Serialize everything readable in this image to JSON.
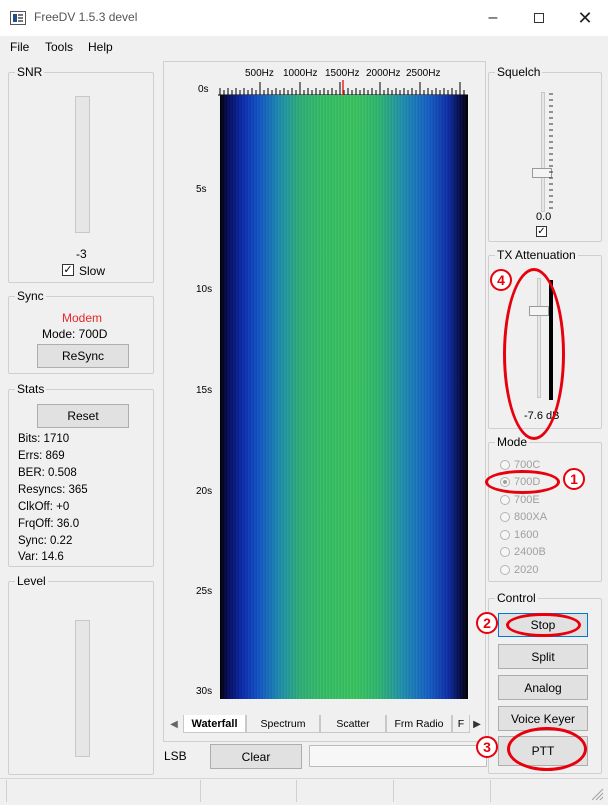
{
  "window": {
    "title": "FreeDV 1.5.3 devel"
  },
  "menu": {
    "items": [
      "File",
      "Tools",
      "Help"
    ]
  },
  "snr": {
    "title": "SNR",
    "value": "-3",
    "slow_label": "Slow"
  },
  "sync": {
    "title": "Sync",
    "status": "Modem",
    "status_color": "#e8262a",
    "mode_text": "Mode: 700D",
    "resync_label": "ReSync"
  },
  "stats": {
    "title": "Stats",
    "reset_label": "Reset",
    "lines": [
      "Bits: 1710",
      "Errs: 869",
      "BER: 0.508",
      "Resyncs: 365",
      "ClkOff: +0",
      "FrqOff: 36.0",
      "Sync: 0.22",
      "Var: 14.6"
    ]
  },
  "level": {
    "title": "Level"
  },
  "waterfall": {
    "freq_labels": [
      "500Hz",
      "1000Hz",
      "1500Hz",
      "2000Hz",
      "2500Hz"
    ],
    "time_labels": [
      "0s",
      "5s",
      "10s",
      "15s",
      "20s",
      "25s",
      "30s"
    ]
  },
  "tabs": {
    "items": [
      "Waterfall",
      "Spectrum",
      "Scatter",
      "Frm Radio",
      "F"
    ],
    "active": "Waterfall"
  },
  "bottom": {
    "sideband": "LSB",
    "clear_label": "Clear"
  },
  "squelch": {
    "title": "Squelch",
    "value": "0.0"
  },
  "tx_attenuation": {
    "title": "TX Attenuation",
    "value": "-7.6 dB"
  },
  "mode": {
    "title": "Mode",
    "options": [
      "700C",
      "700D",
      "700E",
      "800XA",
      "1600",
      "2400B",
      "2020"
    ],
    "selected": "700D"
  },
  "control": {
    "title": "Control",
    "stop_label": "Stop",
    "split_label": "Split",
    "analog_label": "Analog",
    "voice_keyer_label": "Voice Keyer",
    "ptt_label": "PTT"
  },
  "annotations": {
    "color": "#e8000c",
    "n1": "1",
    "n2": "2",
    "n3": "3",
    "n4": "4"
  },
  "icons": {
    "close": "close-icon",
    "maximize": "maximize-icon",
    "minimize": "minimize-icon",
    "tab_left": "chevron-left-icon",
    "tab_right": "chevron-right-icon",
    "checkbox": "checkbox-checked-icon"
  }
}
